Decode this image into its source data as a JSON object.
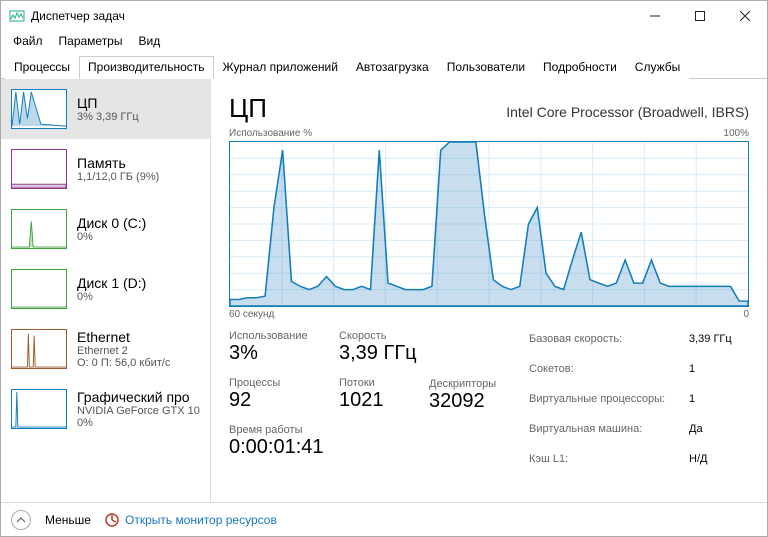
{
  "window": {
    "title": "Диспетчер задач"
  },
  "menubar": {
    "file": "Файл",
    "options": "Параметры",
    "view": "Вид"
  },
  "tabs": {
    "processes": "Процессы",
    "performance": "Производительность",
    "apphistory": "Журнал приложений",
    "startup": "Автозагрузка",
    "users": "Пользователи",
    "details": "Подробности",
    "services": "Службы"
  },
  "sidebar": [
    {
      "name": "ЦП",
      "sub": "3% 3,39 ГГц",
      "color": "#117dbb"
    },
    {
      "name": "Память",
      "sub": "1,1/12,0 ГБ (9%)",
      "color": "#8b3a8b"
    },
    {
      "name": "Диск 0 (C:)",
      "sub": "0%",
      "color": "#3fa33f"
    },
    {
      "name": "Диск 1 (D:)",
      "sub": "0%",
      "color": "#3fa33f"
    },
    {
      "name": "Ethernet",
      "sub": "Ethernet 2",
      "sub2": "О: 0 П: 56,0 кбит/с",
      "color": "#a05a2c"
    },
    {
      "name": "Графический про",
      "sub": "NVIDIA GeForce GTX 10",
      "sub2": "0%",
      "color": "#117dbb"
    }
  ],
  "main": {
    "title": "ЦП",
    "model": "Intel Core Processor (Broadwell, IBRS)",
    "usage_label": "Использование %",
    "usage_max": "100%",
    "axis_left": "60 секунд",
    "axis_right": "0",
    "stats": {
      "usage": {
        "label": "Использование",
        "value": "3%"
      },
      "speed": {
        "label": "Скорость",
        "value": "3,39 ГГц"
      },
      "processes": {
        "label": "Процессы",
        "value": "92"
      },
      "threads": {
        "label": "Потоки",
        "value": "1021"
      },
      "handles": {
        "label": "Дескрипторы",
        "value": "32092"
      },
      "uptime": {
        "label": "Время работы",
        "value": "0:00:01:41"
      }
    },
    "info": {
      "base": {
        "k": "Базовая скорость:",
        "v": "3,39 ГГц"
      },
      "sockets": {
        "k": "Сокетов:",
        "v": "1"
      },
      "vproc": {
        "k": "Виртуальные процессоры:",
        "v": "1"
      },
      "vm": {
        "k": "Виртуальная машина:",
        "v": "Да"
      },
      "l1": {
        "k": "Кэш L1:",
        "v": "Н/Д"
      }
    }
  },
  "footer": {
    "less": "Меньше",
    "resmon": "Открыть монитор ресурсов"
  },
  "chart_data": {
    "type": "area",
    "title": "Использование %",
    "xlabel": "60 секунд",
    "ylabel": "%",
    "ylim": [
      0,
      100
    ],
    "x": [
      0,
      1,
      2,
      3,
      4,
      5,
      6,
      7,
      8,
      9,
      10,
      11,
      12,
      13,
      14,
      15,
      16,
      17,
      18,
      19,
      20,
      21,
      22,
      23,
      24,
      25,
      26,
      27,
      28,
      29,
      30,
      31,
      32,
      33,
      34,
      35,
      36,
      37,
      38,
      39,
      40,
      41,
      42,
      43,
      44,
      45,
      46,
      47,
      48,
      49,
      50,
      51,
      52,
      53,
      54,
      55,
      56,
      57,
      58,
      59
    ],
    "values": [
      4,
      4,
      5,
      5,
      6,
      60,
      95,
      15,
      12,
      10,
      12,
      18,
      12,
      10,
      10,
      12,
      10,
      95,
      14,
      12,
      10,
      10,
      10,
      12,
      95,
      100,
      100,
      100,
      100,
      55,
      16,
      12,
      10,
      12,
      50,
      60,
      20,
      12,
      10,
      28,
      45,
      16,
      14,
      12,
      14,
      28,
      14,
      14,
      28,
      14,
      12,
      12,
      12,
      12,
      12,
      12,
      12,
      12,
      3,
      3
    ]
  }
}
